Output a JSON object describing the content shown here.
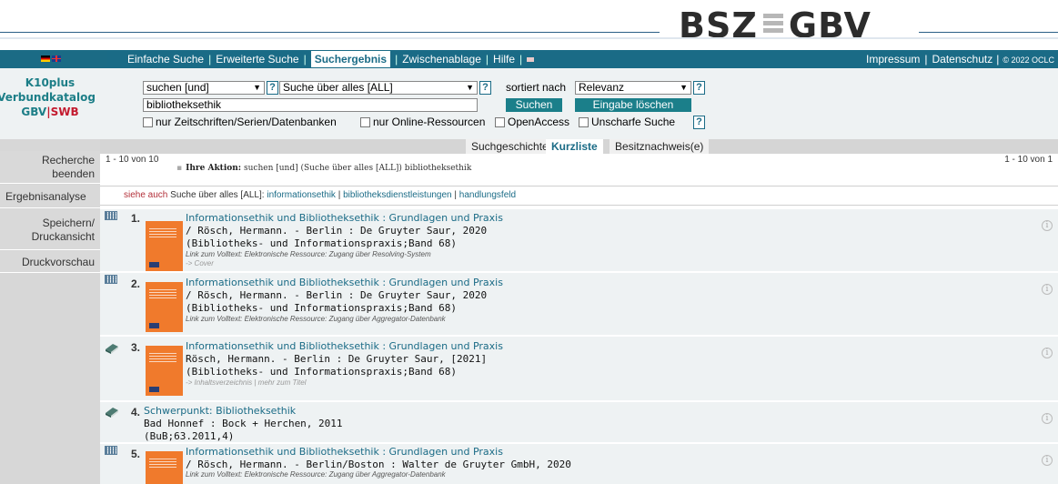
{
  "header": {
    "logo_left": "BSZ",
    "logo_right": "GBV"
  },
  "nav": {
    "items": [
      "Einfache Suche",
      "Erweiterte Suche",
      "Suchergebnis",
      "Zwischenablage",
      "Hilfe"
    ],
    "mail_icon": "mail-icon",
    "right": {
      "impressum": "Impressum",
      "datenschutz": "Datenschutz",
      "copyright": "© 2022 OCLC"
    }
  },
  "brand": {
    "line1": "K10plus",
    "line2": "Verbundkatalog",
    "gbv": "GBV",
    "sep": "|",
    "swb": "SWB"
  },
  "sidebar": {
    "items": [
      "Recherche beenden",
      "Ergebnisanalyse",
      "Speichern/ Druckansicht",
      "Druckvorschau"
    ]
  },
  "search": {
    "operator": "suchen [und]",
    "field": "Suche über alles [ALL]",
    "sort_label": "sortiert nach",
    "sort_value": "Relevanz",
    "query": "bibliotheksethik",
    "search_button": "Suchen",
    "clear_button": "Eingabe löschen",
    "checkboxes": [
      "nur Zeitschriften/Serien/Datenbanken",
      "nur Online-Ressourcen",
      "OpenAccess",
      "Unscharfe Suche"
    ],
    "help": "?"
  },
  "tabs": [
    "Suchgeschichte",
    "Kurzliste",
    "Besitznachweis(e)"
  ],
  "results_header": {
    "count_left": "1 - 10 von 10",
    "count_right": "1 - 10 von 1",
    "action_label": "Ihre Aktion:",
    "action_text": "suchen [und] (Suche über alles [ALL]) bibliotheksethik"
  },
  "see_also": {
    "label": "siehe auch",
    "prefix": "Suche über alles [ALL]:",
    "links": [
      "informationsethik",
      "bibliotheksdienstleistungen",
      "handlungsfeld"
    ]
  },
  "results": [
    {
      "num": "1.",
      "icon": "online-resource-icon",
      "title": "Informationsethik und Bibliotheksethik : Grundlagen und Praxis",
      "author": "/ Rösch, Hermann. - Berlin : De Gruyter Saur, 2020",
      "series": "(Bibliotheks- und Informationspraxis;Band 68)",
      "link_label": "Link zum Volltext:",
      "link_text": "Elektronische Ressource: Zugang über Resolving-System",
      "extra": "-> Cover"
    },
    {
      "num": "2.",
      "icon": "online-resource-icon",
      "title": "Informationsethik und Bibliotheksethik : Grundlagen und Praxis",
      "author": "/ Rösch, Hermann. - Berlin : De Gruyter Saur, 2020",
      "series": "(Bibliotheks- und Informationspraxis;Band 68)",
      "link_label": "Link zum Volltext:",
      "link_text": "Elektronische Ressource: Zugang über Aggregator-Datenbank"
    },
    {
      "num": "3.",
      "icon": "book-icon",
      "title": "Informationsethik und Bibliotheksethik : Grundlagen und Praxis",
      "author": "Rösch, Hermann. - Berlin : De Gruyter Saur, [2021]",
      "series": "(Bibliotheks- und Informationspraxis;Band 68)",
      "extra": "-> Inhaltsverzeichnis | mehr zum Titel"
    },
    {
      "num": "4.",
      "icon": "book-icon",
      "title": "Schwerpunkt: Bibliotheksethik",
      "author": "Bad Honnef : Bock + Herchen, 2011",
      "series": "(BuB;63.2011,4)"
    },
    {
      "num": "5.",
      "icon": "online-resource-icon",
      "title": "Informationsethik und Bibliotheksethik : Grundlagen und Praxis",
      "author": "/ Rösch, Hermann. - Berlin/Boston : Walter de Gruyter GmbH, 2020",
      "link_label": "Link zum Volltext:",
      "link_text": "Elektronische Ressource: Zugang über Aggregator-Datenbank"
    }
  ],
  "info_icon": "info-icon"
}
